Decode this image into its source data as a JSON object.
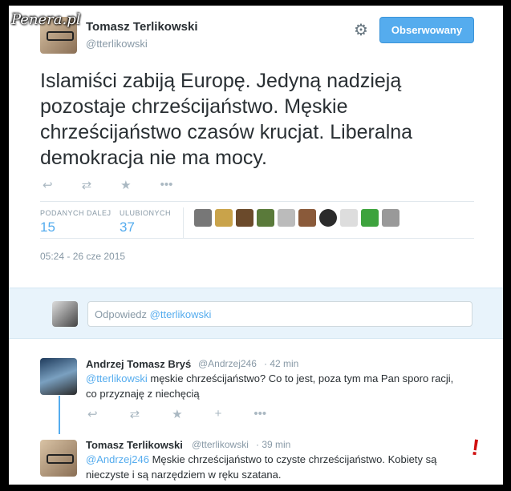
{
  "watermark": "Penera.pl",
  "tweet": {
    "author_name": "Tomasz Terlikowski",
    "author_handle": "@tterlikowski",
    "follow_label": "Obserwowany",
    "text": "Islamiści zabiją Europę. Jedyną nadzieją pozostaje chrześcijaństwo. Męskie chrześcijaństwo czasów krucjat. Liberalna demokracja nie ma mocy.",
    "retweets_label": "PODANYCH DALEJ",
    "retweets": "15",
    "favorites_label": "ULUBIONYCH",
    "favorites": "37",
    "timestamp": "05:24 - 26 cze 2015"
  },
  "reply_box": {
    "prefix": "Odpowiedz",
    "mention": "@tterlikowski"
  },
  "replies": [
    {
      "name": "Andrzej Tomasz Bryś",
      "handle": "@Andrzej246",
      "time": "· 42 min",
      "mention": "@tterlikowski",
      "text": " męskie chrześcijaństwo?  Co to jest,  poza tym ma Pan sporo racji,  co przyznaję z niechęcią"
    },
    {
      "name": "Tomasz Terlikowski",
      "handle": "@tterlikowski",
      "time": "· 39 min",
      "mention": "@Andrzej246",
      "text": " Męskie chrześcijaństwo to czyste chrześcijaństwo. Kobiety są nieczyste i są narzędziem w ręku szatana."
    }
  ],
  "icons": {
    "reply": "reply-icon",
    "retweet": "retweet-icon",
    "favorite": "star-icon",
    "more": "more-icon",
    "follow": "follow-icon",
    "settings": "gear-icon"
  },
  "colors": {
    "accent": "#55acee",
    "text": "#292f33",
    "muted": "#8899a6"
  }
}
